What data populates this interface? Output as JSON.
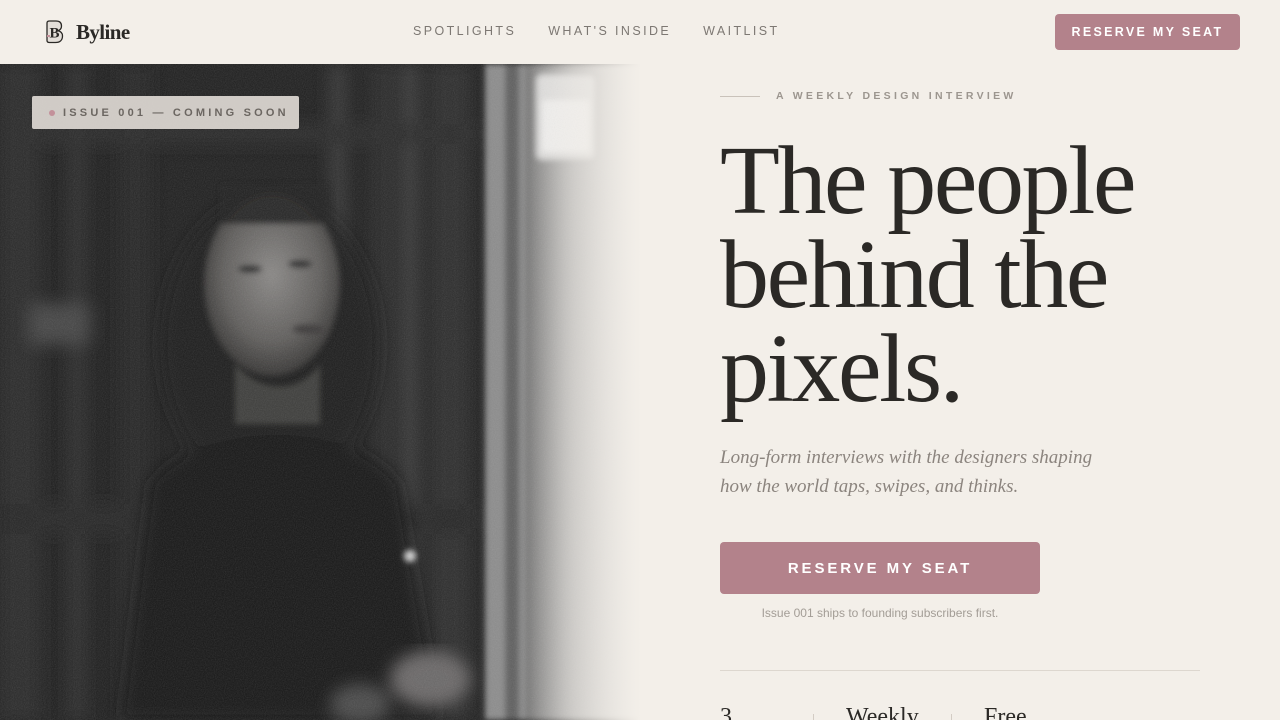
{
  "brand": {
    "logo_icon": "b-monogram-logo-icon",
    "name": "Byline"
  },
  "nav": {
    "links": [
      "SPOTLIGHTS",
      "WHAT'S INSIDE",
      "WAITLIST"
    ],
    "cta_label": "RESERVE MY SEAT"
  },
  "hero": {
    "badge": "ISSUE 001 — COMING SOON",
    "eyebrow": "A WEEKLY DESIGN INTERVIEW",
    "headline": [
      "The people",
      "behind the",
      "pixels."
    ],
    "subhead": "Long-form interviews with the designers shaping how the world taps, swipes, and thinks.",
    "cta_label": "RESERVE MY SEAT",
    "cta_note": "Issue 001 ships to founding subscribers first.",
    "stats": [
      "3",
      "Weekly",
      "Free"
    ]
  },
  "colors": {
    "background": "#f3efe9",
    "accent": "#b3828b",
    "text": "#2b2926",
    "muted": "#8b847e"
  }
}
